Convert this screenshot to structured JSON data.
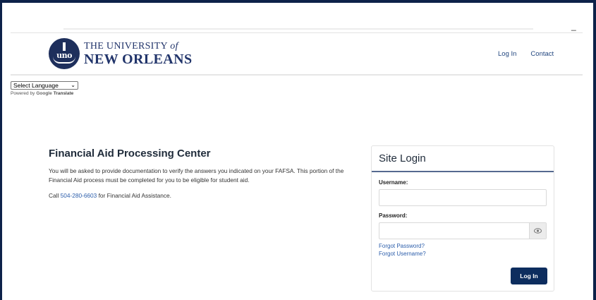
{
  "window": {
    "minimize_glyph": "_"
  },
  "logo": {
    "seal_text": "uno",
    "line1": "THE UNIVERSITY",
    "line1_of": "of",
    "line2": "NEW ORLEANS"
  },
  "nav": {
    "login": "Log In",
    "contact": "Contact"
  },
  "translate": {
    "selected": "Select Language",
    "powered_by": "Powered by",
    "google": "Google",
    "translate": "Translate"
  },
  "main": {
    "title": "Financial Aid Processing Center",
    "paragraph1": "You will be asked to provide documentation to verify the answers you indicated on your FAFSA. This portion of the Financial Aid process must be completed for you to be eligible for student aid.",
    "call_prefix": "Call",
    "phone": "504-280-6603",
    "call_suffix": "for Financial Aid Assistance."
  },
  "login": {
    "title": "Site Login",
    "username_label": "Username:",
    "username_value": "",
    "password_label": "Password:",
    "password_value": "",
    "forgot_password": "Forgot Password?",
    "forgot_username": "Forgot Username?",
    "button": "Log In"
  },
  "colors": {
    "navy": "#0d2d5e",
    "link": "#2c5eab",
    "frame": "#0d2249"
  }
}
